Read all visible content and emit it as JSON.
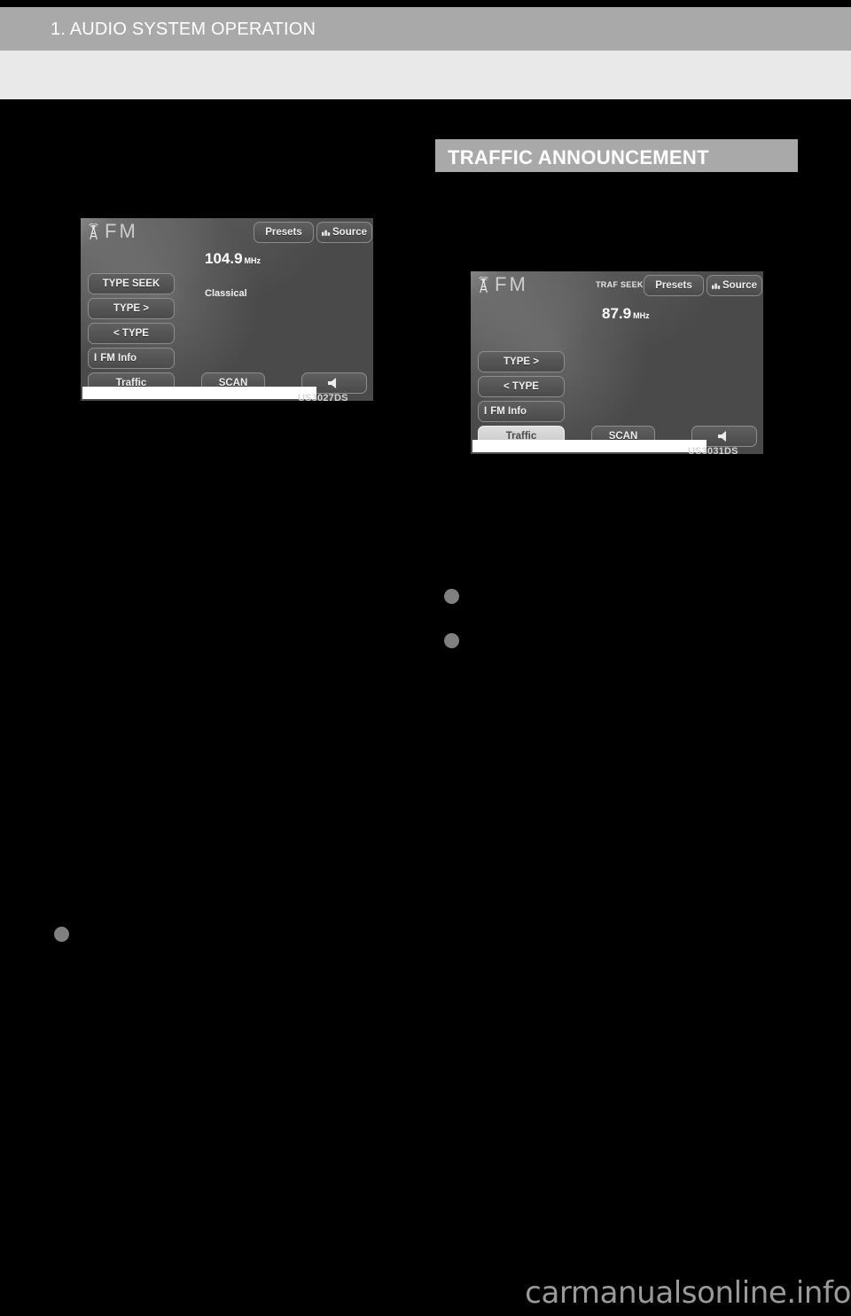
{
  "page": {
    "chapter_title": "1. AUDIO SYSTEM OPERATION",
    "watermark": "carmanualsonline.info"
  },
  "section": {
    "heading": "TRAFFIC ANNOUNCEMENT"
  },
  "figures": [
    {
      "id": "fm-type-seek-screen",
      "label": "US3027DS",
      "band": "FM",
      "frequency": "104.9",
      "frequency_unit": "MHz",
      "genre": "Classical",
      "status": "",
      "buttons": {
        "presets": "Presets",
        "source": "Source",
        "type_seek": "TYPE SEEK",
        "type_next": "TYPE >",
        "type_prev": "< TYPE",
        "fm_info": "FM Info",
        "fm_info_prefix": "I",
        "traffic": "Traffic",
        "scan": "SCAN",
        "volume": "speaker-icon"
      },
      "highlighted": []
    },
    {
      "id": "fm-traffic-screen",
      "label": "US3031DS",
      "band": "FM",
      "frequency": "87.9",
      "frequency_unit": "MHz",
      "genre": "",
      "status": "TRAF SEEK",
      "buttons": {
        "presets": "Presets",
        "source": "Source",
        "type_seek": "",
        "type_next": "TYPE >",
        "type_prev": "< TYPE",
        "fm_info": "FM Info",
        "fm_info_prefix": "I",
        "traffic": "Traffic",
        "scan": "SCAN",
        "volume": "speaker-icon"
      },
      "highlighted": [
        "traffic"
      ]
    }
  ],
  "bullets": {
    "left": [
      ""
    ],
    "right": [
      "",
      ""
    ]
  },
  "body_text": {
    "left_column": "",
    "right_column": ""
  },
  "colors": {
    "header_bar": "#a9a9a9",
    "sub_band": "#e9e9e9",
    "page_background": "#000000",
    "bullet": "#808080",
    "watermark": "#9a9a9a"
  }
}
